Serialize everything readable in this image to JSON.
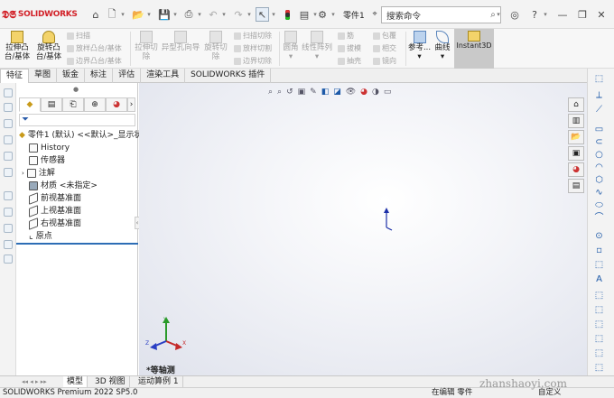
{
  "app": {
    "brand": "SOLIDWORKS",
    "doc_name": "零件1"
  },
  "search": {
    "placeholder": "搜索命令"
  },
  "ribbon": {
    "big": [
      {
        "label1": "拉伸凸",
        "label2": "台/基体"
      },
      {
        "label1": "旋转凸",
        "label2": "台/基体"
      }
    ],
    "small_col1": [
      "扫描",
      "放样凸台/基体",
      "边界凸台/基体"
    ],
    "big_gray": [
      {
        "label1": "拉伸切",
        "label2": "除"
      },
      {
        "label1": "异型孔向导",
        "label2": ""
      },
      {
        "label1": "旋转切",
        "label2": "除"
      }
    ],
    "small_col2": [
      "扫描切除",
      "放样切割",
      "边界切除"
    ],
    "big_gray2": [
      {
        "label1": "圆角",
        "label2": ""
      },
      {
        "label1": "线性阵列",
        "label2": ""
      }
    ],
    "small_col3": [
      "筋",
      "拔模",
      "抽壳"
    ],
    "small_col4": [
      "包覆",
      "相交",
      "镜向"
    ],
    "ref": "参考...",
    "curve": "曲线",
    "instant": "Instant3D"
  },
  "tabs": [
    "特征",
    "草图",
    "钣金",
    "标注",
    "评估",
    "渲染工具",
    "SOLIDWORKS 插件"
  ],
  "tree": {
    "root": "零件1 (默认) <<默认>_显示状",
    "items": [
      "History",
      "传感器",
      "注解",
      "材质 <未指定>",
      "前视基准面",
      "上视基准面",
      "右视基准面",
      "原点"
    ]
  },
  "viewport": {
    "view_label": "*等轴测"
  },
  "bottom_tabs": [
    "模型",
    "3D 视图",
    "运动算例 1"
  ],
  "status": {
    "left": "SOLIDWORKS Premium 2022 SP5.0",
    "mid": "在编辑 零件",
    "right": "自定义"
  },
  "watermark": "zhanshaoyi.com",
  "colors": {
    "brand": "#d22128",
    "accent": "#2d6db5",
    "icon_blue": "#1e5aa8"
  }
}
